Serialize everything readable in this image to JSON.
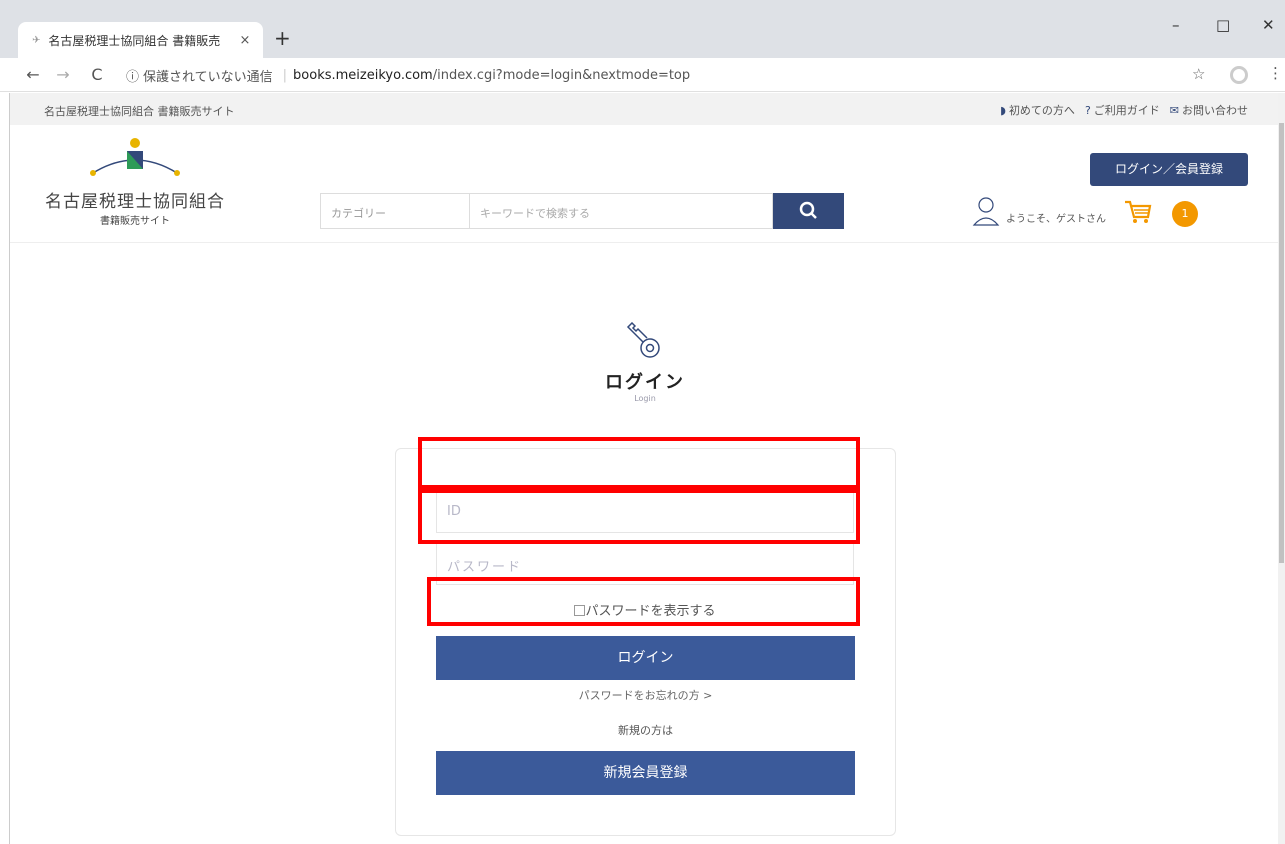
{
  "browser": {
    "tab_title": "名古屋税理士協同組合 書籍販売",
    "tab_close": "×",
    "new_tab": "+",
    "security_label": "保護されていない通信",
    "url_host": "books.meizeikyo.com",
    "url_path": "/index.cgi?mode=login&nextmode=top",
    "controls": {
      "minimize": "–",
      "maximize": "□",
      "close": "✕"
    }
  },
  "util_bar": {
    "site_name": "名古屋税理士協同組合 書籍販売サイト",
    "links": [
      {
        "label": "初めての方へ",
        "icon": "beginner-icon"
      },
      {
        "label": "ご利用ガイド",
        "icon": "help-icon"
      },
      {
        "label": "お問い合わせ",
        "icon": "mail-icon"
      }
    ]
  },
  "header": {
    "logo_name": "名古屋税理士協同組合",
    "logo_sub": "書籍販売サイト",
    "category_placeholder": "カテゴリー",
    "keyword_placeholder": "キーワードで検索する",
    "login_register": "ログイン／会員登録",
    "welcome": "ようこそ、ゲストさん",
    "cart_count": "1"
  },
  "login": {
    "title": "ログイン",
    "subtitle": "Login",
    "id_placeholder": "ID",
    "password_placeholder": "パスワード",
    "show_password": "パスワードを表示する",
    "login_button": "ログイン",
    "forgot": "パスワードをお忘れの方 >",
    "new_prompt": "新規の方は",
    "register_button": "新規会員登録"
  },
  "colors": {
    "brand": "#33497a",
    "button": "#3b5a9a",
    "badge": "#f39800",
    "highlight": "#ff0000"
  }
}
